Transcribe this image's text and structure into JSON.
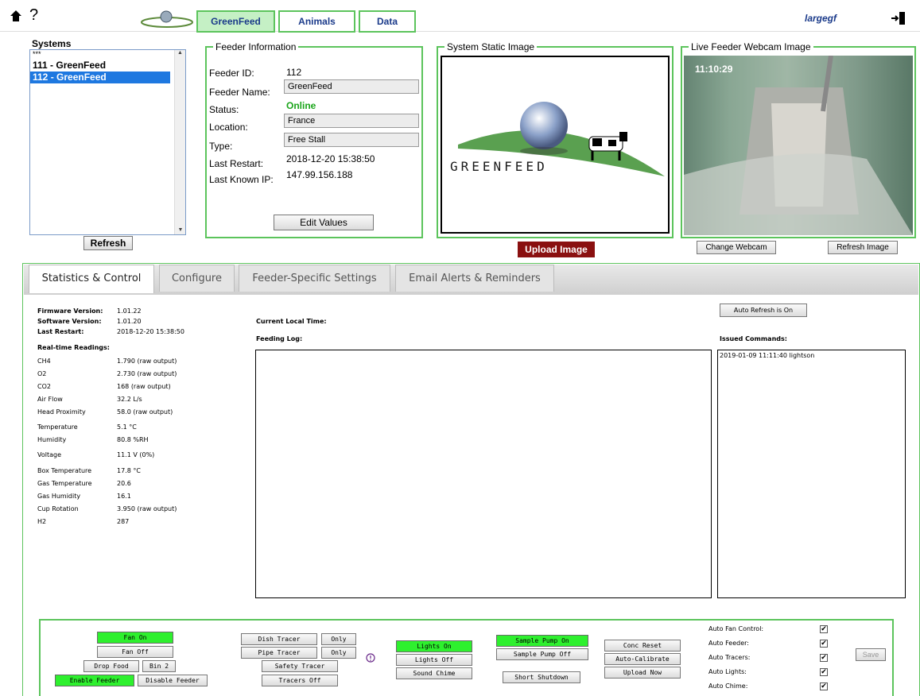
{
  "topbar": {
    "tabs": [
      {
        "label": "GreenFeed"
      },
      {
        "label": "Animals"
      },
      {
        "label": "Data"
      }
    ],
    "username": "largegf",
    "help_glyph": "?",
    "icons": [
      "home-icon",
      "help-icon",
      "logout-icon"
    ]
  },
  "systems": {
    "title": "Systems",
    "items": [
      {
        "label": "***"
      },
      {
        "label": "111 - GreenFeed"
      },
      {
        "label": "112 - GreenFeed"
      }
    ],
    "selected_index": 2,
    "refresh_label": "Refresh"
  },
  "feeder_info": {
    "legend": "Feeder Information",
    "id_label": "Feeder ID:",
    "id_value": "112",
    "name_label": "Feeder Name:",
    "name_value": "GreenFeed",
    "status_label": "Status:",
    "status_value": "Online",
    "location_label": "Location:",
    "location_value": "France",
    "type_label": "Type:",
    "type_value": "Free Stall",
    "restart_label": "Last Restart:",
    "restart_value": "2018-12-20 15:38:50",
    "ip_label": "Last Known IP:",
    "ip_value": "147.99.156.188",
    "edit_label": "Edit Values"
  },
  "static_image": {
    "legend": "System Static Image",
    "logo_text": "GREENFEED",
    "upload_label": "Upload Image"
  },
  "webcam": {
    "legend": "Live Feeder Webcam Image",
    "timestamp": "11:10:29",
    "change_label": "Change Webcam",
    "refresh_label": "Refresh Image"
  },
  "main_tabs": [
    {
      "label": "Statistics & Control"
    },
    {
      "label": "Configure"
    },
    {
      "label": "Feeder-Specific Settings"
    },
    {
      "label": "Email Alerts & Reminders"
    }
  ],
  "stats": {
    "firmware_label": "Firmware Version:",
    "firmware_value": "1.01.22",
    "software_label": "Software Version:",
    "software_value": "1.01.20",
    "restart_label": "Last Restart:",
    "restart_value": "2018-12-20 15:38:50",
    "readings_title": "Real-time Readings:",
    "readings": [
      {
        "k": "CH4",
        "v": "1.790 (raw output)"
      },
      {
        "k": "O2",
        "v": "2.730 (raw output)"
      },
      {
        "k": "CO2",
        "v": "168 (raw output)"
      },
      {
        "k": "Air Flow",
        "v": "32.2 L/s"
      },
      {
        "k": "Head Proximity",
        "v": "58.0 (raw output)"
      },
      {
        "k": "Temperature",
        "v": "5.1 °C"
      },
      {
        "k": "Humidity",
        "v": "80.8 %RH"
      },
      {
        "k": "Voltage",
        "v": "11.1 V (0%)"
      },
      {
        "k": "Box Temperature",
        "v": "17.8 °C"
      },
      {
        "k": "Gas Temperature",
        "v": "20.6"
      },
      {
        "k": "Gas Humidity",
        "v": "16.1"
      },
      {
        "k": "Cup Rotation",
        "v": "3.950 (raw output)"
      },
      {
        "k": "H2",
        "v": "287"
      }
    ]
  },
  "log": {
    "current_time_label": "Current Local Time:",
    "feeding_log_label": "Feeding Log:",
    "auto_refresh_label": "Auto Refresh is On",
    "issued_label": "Issued Commands:",
    "issued_entries": [
      "2019-01-09 11:11:40 lightson"
    ]
  },
  "controls": {
    "fan_on": "Fan On",
    "fan_off": "Fan Off",
    "drop_food": "Drop Food",
    "bin2": "Bin 2",
    "enable_feeder": "Enable Feeder",
    "disable_feeder": "Disable Feeder",
    "dish_tracer": "Dish Tracer",
    "pipe_tracer": "Pipe Tracer",
    "only": "Only",
    "safety_tracer": "Safety Tracer",
    "tracers_off": "Tracers Off",
    "lights_on": "Lights On",
    "lights_off": "Lights Off",
    "sound_chime": "Sound Chime",
    "sample_pump_on": "Sample Pump On",
    "sample_pump_off": "Sample Pump Off",
    "short_shutdown": "Short Shutdown",
    "conc_reset": "Conc Reset",
    "auto_calibrate": "Auto-Calibrate",
    "upload_now": "Upload Now",
    "auto_fan": "Auto Fan Control:",
    "auto_feeder": "Auto Feeder:",
    "auto_tracers": "Auto Tracers:",
    "auto_lights": "Auto Lights:",
    "auto_chime": "Auto Chime:",
    "save": "Save",
    "check_glyph": "✔"
  }
}
